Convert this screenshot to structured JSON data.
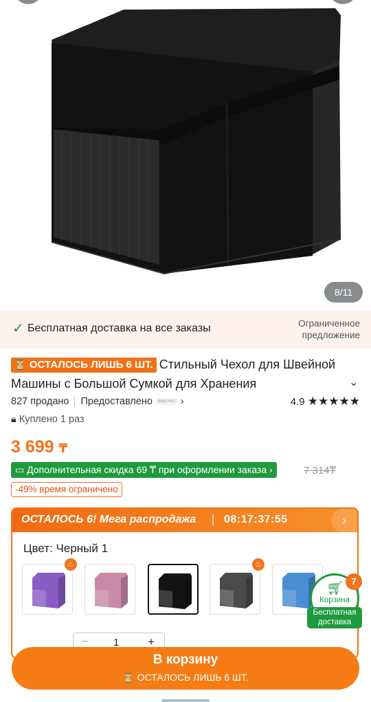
{
  "gallery": {
    "counter": "8/11"
  },
  "shipping": {
    "text": "Бесплатная доставка на все заказы",
    "offer": "Ограниченное предложение"
  },
  "product": {
    "badge": "ОСТАЛОСЬ ЛИШЬ 6 ШТ.",
    "title": "Стильный Чехол для Швейной Машины с Большой Сумкой для Хранения",
    "sold": "827 продано",
    "provided": "Предоставлено",
    "provider_logo": "RING HAO",
    "rating": "4.9",
    "stars": "★★★★★",
    "bought": "Куплено 1 раз",
    "price": "3 699",
    "currency": "₸",
    "extra_discount": "Дополнительная скидка 69 ₸ при оформлении заказа",
    "old_price": "7 314₸",
    "discount_note": "-49% время ограничено"
  },
  "sale": {
    "label": "ОСТАЛОСЬ 6! Мега распродажа",
    "timer": "08:17:37:55",
    "color_label": "Цвет: Черный 1",
    "swatches": [
      {
        "name": "purple",
        "color": "#8a5cc4",
        "hot": true
      },
      {
        "name": "pink",
        "color": "#c98aa8",
        "hot": false
      },
      {
        "name": "black",
        "color": "#141414",
        "hot": false,
        "selected": true
      },
      {
        "name": "gray",
        "color": "#4a4a4a",
        "hot": true
      },
      {
        "name": "blue",
        "color": "#4a8ed4",
        "hot": false
      }
    ],
    "qty": "1"
  },
  "cart": {
    "count": "7",
    "label": "Корзина",
    "free_ship": "Бесплатная доставка"
  },
  "bottom": {
    "button": "В корзину",
    "stock_note": "ОСТАЛОСЬ ЛИШЬ 6 ШТ."
  },
  "colors": {
    "accent": "#f0731a",
    "green": "#1f9a3c"
  }
}
